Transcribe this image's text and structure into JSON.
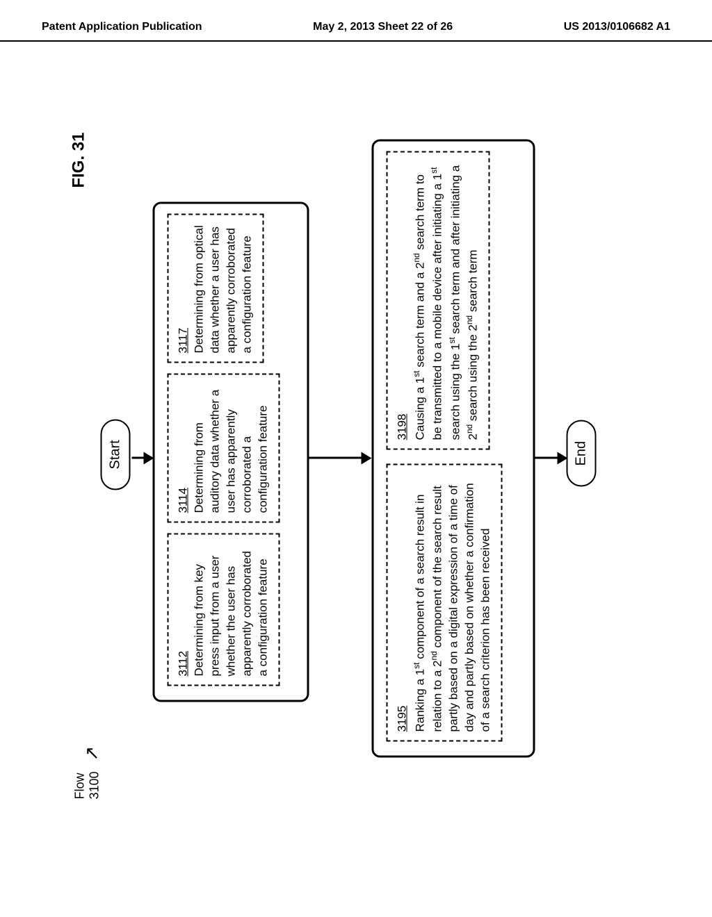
{
  "header": {
    "left": "Patent Application Publication",
    "center": "May 2, 2013  Sheet 22 of 26",
    "right": "US 2013/0106682 A1"
  },
  "flow_label": "Flow\n3100",
  "fig_label": "FIG. 31",
  "start": "Start",
  "end": "End",
  "box1": {
    "s3112": {
      "num": "3112",
      "text": "Determining from key press input from a user whether the user has apparently corroborated a configuration feature"
    },
    "s3114": {
      "num": "3114",
      "text": "Determining from auditory data whether a user has apparently corroborated a configuration feature"
    },
    "s3117": {
      "num": "3117",
      "text": "Determining from optical data whether a user has apparently corroborated a configuration feature"
    }
  },
  "box2": {
    "s3195": {
      "num": "3195",
      "text_html": "Ranking a 1<sup>st</sup> component of a search result in relation to a 2<sup>nd</sup> component of the search result partly based on a digital expression of a time of day and partly based on whether a confirmation of a search criterion has been received"
    },
    "s3198": {
      "num": "3198",
      "text_html": "Causing a 1<sup>st</sup> search term and a 2<sup>nd</sup> search term to be transmitted to a mobile device after initiating a 1<sup>st</sup> search using the 1<sup>st</sup> search term and after initiating a 2<sup>nd</sup> search using the 2<sup>nd</sup> search term"
    }
  }
}
